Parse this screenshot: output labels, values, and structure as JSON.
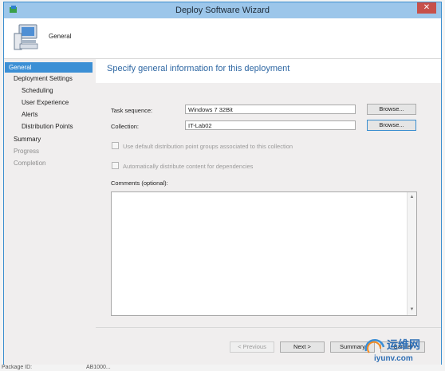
{
  "window": {
    "title": "Deploy Software Wizard",
    "close_glyph": "✕"
  },
  "header": {
    "title": "General",
    "icon": "computer-icon"
  },
  "nav": {
    "items": [
      {
        "label": "General",
        "state": "active"
      },
      {
        "label": "Deployment Settings",
        "state": "normal"
      },
      {
        "label": "Scheduling",
        "state": "normal"
      },
      {
        "label": "User Experience",
        "state": "normal"
      },
      {
        "label": "Alerts",
        "state": "normal"
      },
      {
        "label": "Distribution Points",
        "state": "normal"
      },
      {
        "label": "Summary",
        "state": "normal"
      },
      {
        "label": "Progress",
        "state": "disabled"
      },
      {
        "label": "Completion",
        "state": "disabled"
      }
    ]
  },
  "content": {
    "title": "Specify general information for this deployment",
    "task_sequence_label": "Task sequence:",
    "task_sequence_value": "Windows 7 32Bit",
    "collection_label": "Collection:",
    "collection_value": "IT-Lab02",
    "browse_label": "Browse...",
    "use_default_dp_label": "Use default distribution point groups associated to this collection",
    "auto_distribute_label": "Automatically distribute content for dependencies",
    "comments_label": "Comments (optional):",
    "comments_value": ""
  },
  "footer": {
    "previous_label": "< Previous",
    "next_label": "Next >",
    "summary_label": "Summary",
    "cancel_label": "Cancel"
  },
  "background": {
    "text1": "Package ID:",
    "text2": "AB1000..."
  },
  "watermark": {
    "text_cn": "运维网",
    "text_url": "iyunv.com"
  },
  "colors": {
    "accent": "#3b8fd5",
    "title_blue": "#2e67a3",
    "titlebar": "#9cc6ea"
  }
}
